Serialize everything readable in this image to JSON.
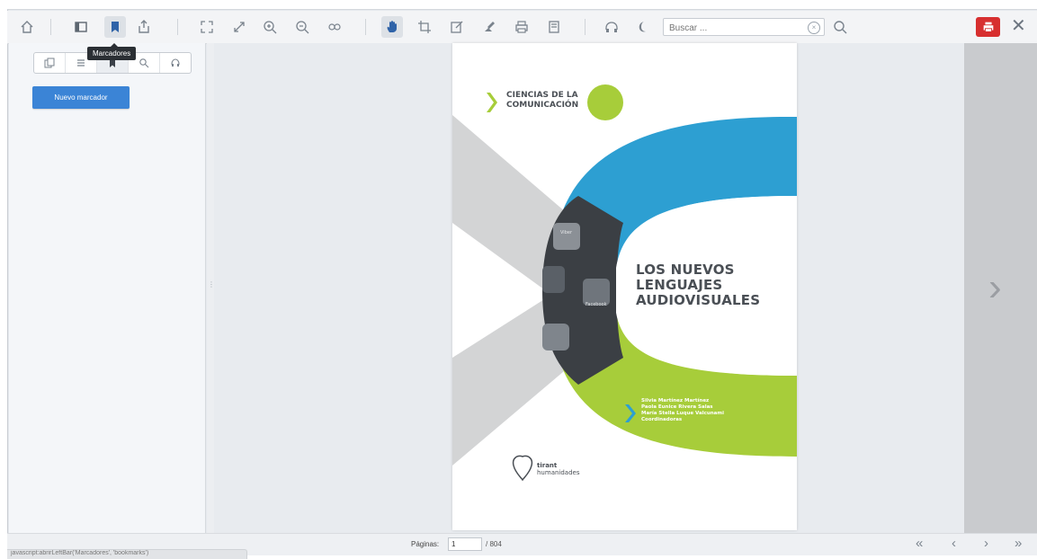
{
  "toolbar": {
    "search_placeholder": "Buscar ...",
    "tooltip": "Marcadores"
  },
  "sidebar": {
    "new_bookmark_label": "Nuevo marcador"
  },
  "book": {
    "series": "CIENCIAS DE LA COMUNICACIÓN",
    "series_line1": "CIENCIAS DE LA",
    "series_line2": "COMUNICACIÓN",
    "title_line1": "LOS NUEVOS",
    "title_line2": "LENGUAJES",
    "title_line3": "AUDIOVISUALES",
    "authors": [
      "Silvia Martínez Martínez",
      "Paola Eunice Rivera Salas",
      "María Stella Luque Valcunami"
    ],
    "role": "Coordinadoras",
    "publisher_line1": "tirant",
    "publisher_line2": "humanidades",
    "app_labels": [
      "Viber",
      "Facebook"
    ]
  },
  "footer": {
    "pages_label": "Páginas:",
    "current_page": "1",
    "total_pages": "/ 804",
    "url_text": "javascript:abrirLeftBar('Marcadores', 'bookmarks')"
  },
  "colors": {
    "accent_blue": "#3b84d6",
    "print_red": "#d72f2f",
    "cover_blue": "#2d9fd2",
    "cover_green": "#a7cd3a"
  }
}
